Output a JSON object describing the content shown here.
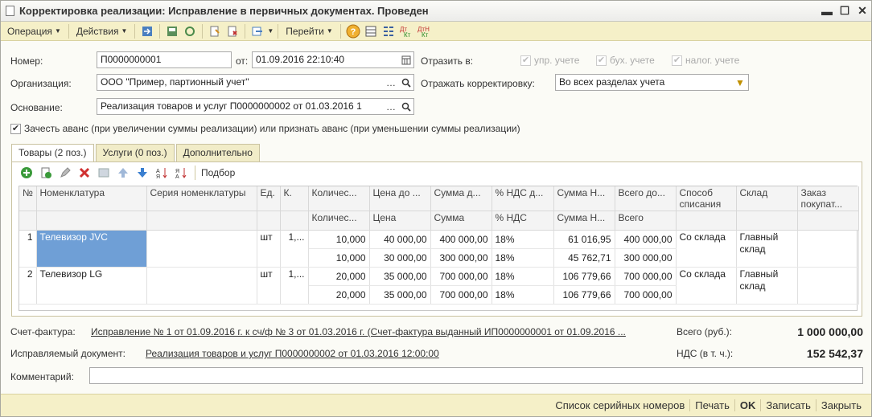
{
  "window": {
    "title": "Корректировка реализации: Исправление в первичных документах. Проведен",
    "minimize": "▬",
    "maximize": "☐",
    "close": "✕"
  },
  "toolbar": {
    "operation": "Операция",
    "actions": "Действия",
    "goto": "Перейти",
    "help": "?"
  },
  "form": {
    "number_label": "Номер:",
    "number": "П0000000001",
    "date_label": "от:",
    "date": "01.09.2016 22:10:40",
    "reflect_label": "Отразить в:",
    "reflect_options": [
      "упр. учете",
      "бух. учете",
      "налог. учете"
    ],
    "org_label": "Организация:",
    "org": "ООО \"Пример, партионный учет\"",
    "reflect_corr_label": "Отражать корректировку:",
    "reflect_corr": "Во всех разделах учета",
    "basis_label": "Основание:",
    "basis": "Реализация товаров и услуг П0000000002 от 01.03.2016 1",
    "advance_label": "Зачесть аванс (при увеличении суммы реализации) или признать аванс (при уменьшении суммы реализации)"
  },
  "tabs": [
    "Товары (2 поз.)",
    "Услуги (0 поз.)",
    "Дополнительно"
  ],
  "table_toolbar": {
    "pick": "Подбор"
  },
  "table": {
    "headers_top": [
      "№",
      "Номенклатура",
      "Серия номенклатуры",
      "Ед.",
      "К.",
      "Количес...",
      "Цена до ...",
      "Сумма д...",
      "% НДС д...",
      "Сумма Н...",
      "Всего до...",
      "Способ списания",
      "Склад",
      "Заказ покупат..."
    ],
    "headers_bottom": [
      "Количес...",
      "Цена",
      "Сумма",
      "% НДС",
      "Сумма Н...",
      "Всего"
    ],
    "rows": [
      {
        "n": "1",
        "name": "Телевизор JVC",
        "series": "",
        "unit": "шт",
        "k": "1,...",
        "before": {
          "qty": "10,000",
          "price": "40 000,00",
          "sum": "400 000,00",
          "vat_rate": "18%",
          "vat": "61 016,95",
          "total": "400 000,00"
        },
        "after": {
          "qty": "10,000",
          "price": "30 000,00",
          "sum": "300 000,00",
          "vat_rate": "18%",
          "vat": "45 762,71",
          "total": "300 000,00"
        },
        "method": "Со склада",
        "warehouse": "Главный склад",
        "order": ""
      },
      {
        "n": "2",
        "name": "Телевизор LG",
        "series": "",
        "unit": "шт",
        "k": "1,...",
        "before": {
          "qty": "20,000",
          "price": "35 000,00",
          "sum": "700 000,00",
          "vat_rate": "18%",
          "vat": "106 779,66",
          "total": "700 000,00"
        },
        "after": {
          "qty": "20,000",
          "price": "35 000,00",
          "sum": "700 000,00",
          "vat_rate": "18%",
          "vat": "106 779,66",
          "total": "700 000,00"
        },
        "method": "Со склада",
        "warehouse": "Главный склад",
        "order": ""
      }
    ]
  },
  "footer": {
    "invoice_label": "Счет-фактура:",
    "invoice_link": "Исправление № 1 от 01.09.2016 г. к сч/ф № 3 от 01.03.2016 г. (Счет-фактура выданный ИП0000000001 от 01.09.2016 ...",
    "total_label": "Всего (руб.):",
    "total": "1 000 000,00",
    "corrected_label": "Исправляемый документ:",
    "corrected_link": "Реализация товаров и услуг П0000000002 от 01.03.2016 12:00:00",
    "vat_label": "НДС (в т. ч.):",
    "vat": "152 542,37",
    "comment_label": "Комментарий:",
    "comment": ""
  },
  "bottom_buttons": {
    "serials": "Список серийных номеров",
    "print": "Печать",
    "ok": "OK",
    "save": "Записать",
    "close": "Закрыть"
  }
}
